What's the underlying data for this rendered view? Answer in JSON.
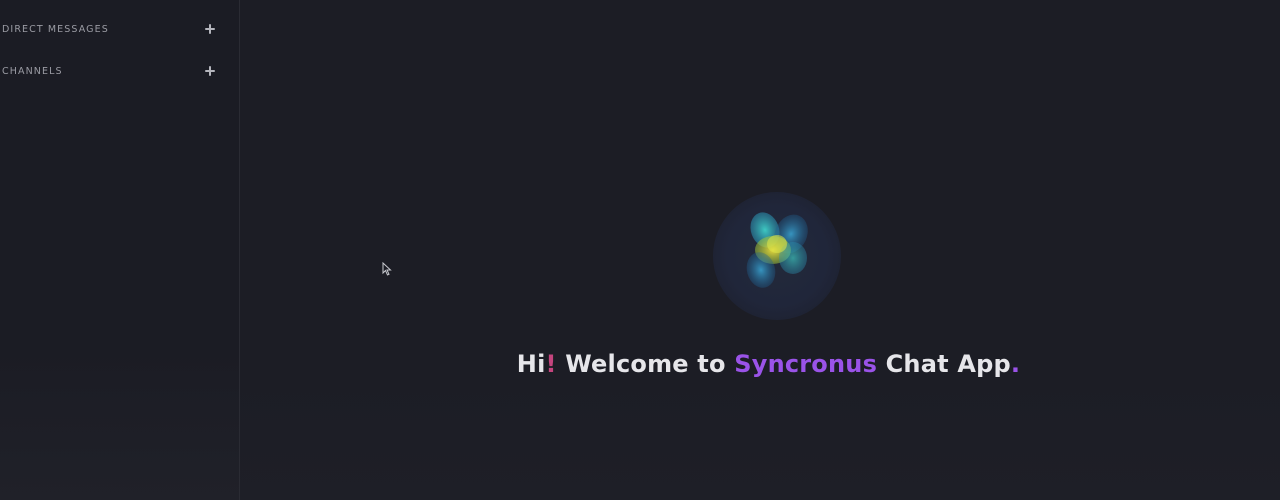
{
  "sidebar": {
    "sections": [
      {
        "label": "DIRECT MESSAGES",
        "action_icon": "plus-icon"
      },
      {
        "label": "CHANNELS",
        "action_icon": "plus-icon"
      }
    ]
  },
  "main": {
    "logo_icon": "app-logo-icon",
    "welcome": {
      "part1": "Hi",
      "exclaim": "!",
      "part2": " Welcome to ",
      "brand": "Syncronus",
      "part3": " Chat App",
      "period": "."
    }
  },
  "colors": {
    "background": "#1c1d25",
    "brand_purple": "#9a53e8",
    "accent_pink": "#c4457e",
    "text": "#e6e6ea"
  }
}
